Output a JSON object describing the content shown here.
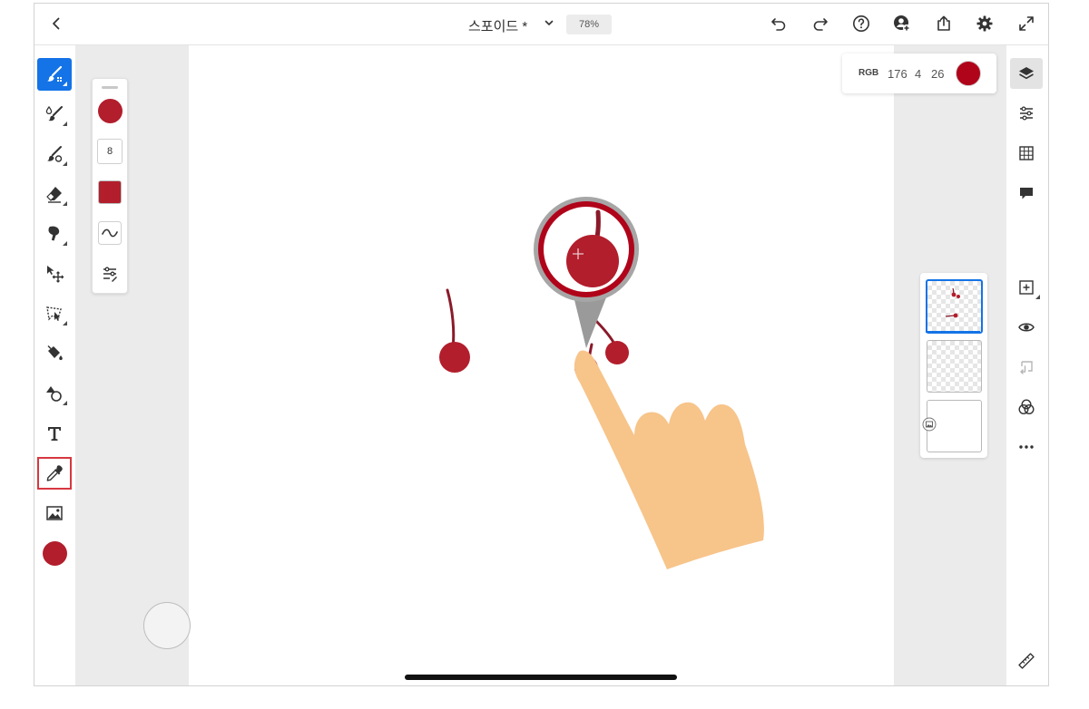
{
  "topbar": {
    "title": "스포이드 *",
    "zoom": "78%"
  },
  "icons": {
    "back": "chevron-left-icon",
    "title_dropdown": "chevron-down-icon",
    "undo": "undo-icon",
    "redo": "redo-icon",
    "help": "help-icon",
    "invite": "invite-user-icon",
    "share": "share-icon",
    "settings": "gear-icon",
    "fullscreen": "fullscreen-icon"
  },
  "left_toolbar": {
    "tools": [
      {
        "name": "pixel-brush",
        "active": true
      },
      {
        "name": "live-brush"
      },
      {
        "name": "vector-brush"
      },
      {
        "name": "eraser"
      },
      {
        "name": "smudge"
      },
      {
        "name": "move-transform"
      },
      {
        "name": "lasso-selection"
      },
      {
        "name": "fill"
      },
      {
        "name": "shapes"
      },
      {
        "name": "text"
      },
      {
        "name": "eyedropper",
        "highlighted": true
      },
      {
        "name": "image"
      },
      {
        "name": "color-swatch"
      }
    ]
  },
  "brush_panel": {
    "size": "8"
  },
  "color_readout": {
    "mode": "RGB",
    "r": "176",
    "g": "4",
    "b": "26",
    "swatch": "#b0041a"
  },
  "colors": {
    "accent": "#1473e6",
    "highlight_box": "#d7373f",
    "sampled": "#b0041a",
    "cherry": "#b21e2c",
    "hand": "#f7c48a"
  },
  "layers": [
    {
      "name": "layer-1",
      "selected": true
    },
    {
      "name": "layer-2"
    },
    {
      "name": "background"
    }
  ]
}
